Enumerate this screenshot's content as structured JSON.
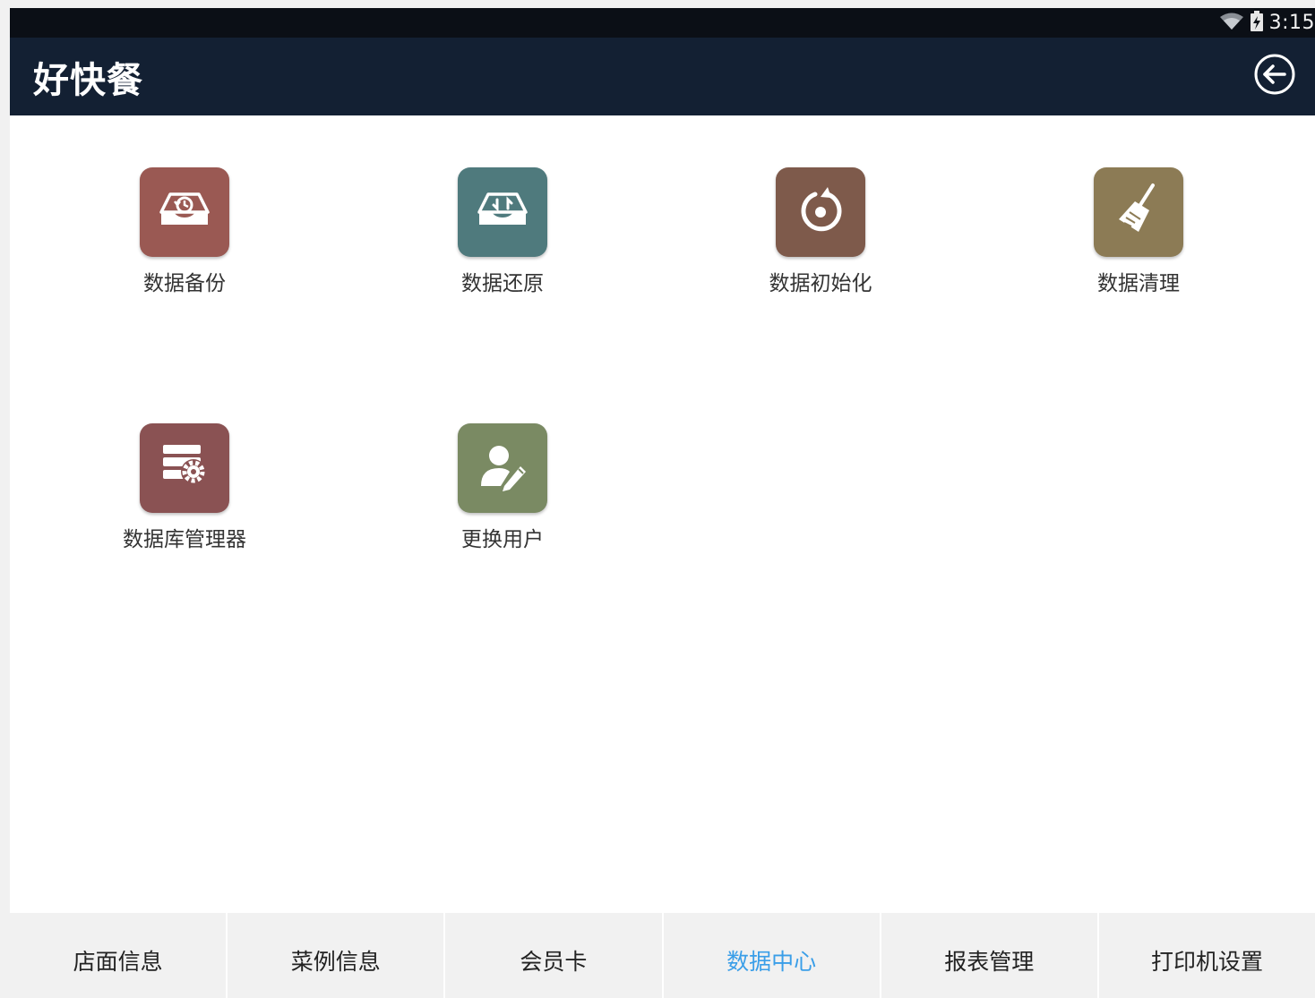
{
  "status_bar": {
    "time": "3:15",
    "icons": [
      "wifi-icon",
      "battery-charging-icon"
    ]
  },
  "app_bar": {
    "title": "好快餐",
    "back_icon": "back-arrow-circle-icon"
  },
  "tiles": [
    {
      "label": "数据备份",
      "icon": "backup-tray-icon",
      "color": "#9a5953"
    },
    {
      "label": "数据还原",
      "icon": "restore-tray-icon",
      "color": "#4f7a7d"
    },
    {
      "label": "数据初始化",
      "icon": "reset-icon",
      "color": "#7e5a4b"
    },
    {
      "label": "数据清理",
      "icon": "broom-icon",
      "color": "#8c7b55"
    },
    {
      "label": "数据库管理器",
      "icon": "database-gear-icon",
      "color": "#8a5253"
    },
    {
      "label": "更换用户",
      "icon": "user-edit-icon",
      "color": "#7a8a63"
    }
  ],
  "tabs": [
    {
      "label": "店面信息",
      "active": false
    },
    {
      "label": "菜例信息",
      "active": false
    },
    {
      "label": "会员卡",
      "active": false
    },
    {
      "label": "数据中心",
      "active": true
    },
    {
      "label": "报表管理",
      "active": false
    },
    {
      "label": "打印机设置",
      "active": false
    }
  ],
  "colors": {
    "app_bar": "#132033",
    "status_bar": "#0b0f16",
    "active_tab": "#3a9ee8"
  }
}
